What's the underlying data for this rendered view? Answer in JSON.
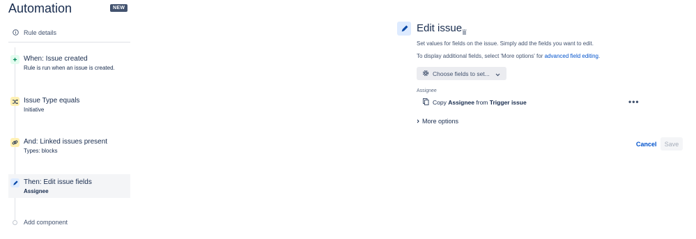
{
  "app": {
    "title": "Automation",
    "badge": "NEW"
  },
  "sidebar": {
    "rule_details": "Rule details",
    "steps": [
      {
        "title": "When: Issue created",
        "subtitle": "Rule is run when an issue is created.",
        "icon": "plus-icon",
        "color": "#e3fcef"
      },
      {
        "title": "Issue Type equals",
        "subtitle": "Initiative",
        "icon": "shuffle-icon",
        "color": "#fff0b3"
      },
      {
        "title": "And: Linked issues present",
        "subtitle": "Types: blocks",
        "icon": "link-icon",
        "color": "#fff0b3"
      },
      {
        "title": "Then: Edit issue fields",
        "subtitle": "Assignee",
        "icon": "pencil-icon",
        "color": "#deebff"
      }
    ],
    "add_component": "Add component"
  },
  "panel": {
    "title": "Edit issue",
    "description": "Set values for fields on the issue. Simply add the fields you want to edit.",
    "description2_prefix": "To display additional fields, select 'More options' for ",
    "description2_link": "advanced field editing",
    "description2_suffix": ".",
    "choose_fields": "Choose fields to set...",
    "field_label": "Assignee",
    "copy": {
      "prefix": "Copy",
      "field": "Assignee",
      "middle": "from",
      "source": "Trigger issue"
    },
    "more_options": "More options",
    "cancel": "Cancel",
    "save": "Save"
  },
  "colors": {
    "accent": "#0052cc",
    "text": "#172b4d"
  }
}
